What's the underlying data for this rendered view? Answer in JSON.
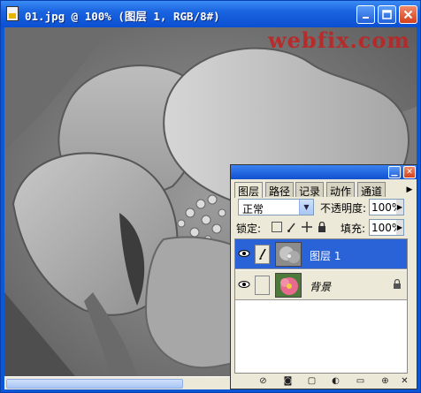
{
  "window": {
    "title": "01.jpg @ 100% (图层 1, RGB/8#)",
    "watermark": "webfix.com"
  },
  "layers_panel": {
    "tabs": [
      "图层",
      "路径",
      "记录",
      "动作",
      "通道"
    ],
    "active_tab": "图层",
    "blend_mode": "正常",
    "opacity_label": "不透明度:",
    "opacity_value": "100%",
    "lock_label": "锁定:",
    "fill_label": "填充:",
    "fill_value": "100%",
    "layers": [
      {
        "name": "图层 1",
        "selected": true,
        "locked": false
      },
      {
        "name": "背景",
        "selected": false,
        "locked": true
      }
    ]
  },
  "icons": {
    "window_minimize": "minimize-icon",
    "window_maximize": "maximize-icon",
    "window_close": "close-icon",
    "eye": "eye-icon",
    "brush": "brush-icon",
    "lock": "lock-icon",
    "bottom_bar": [
      "link-layers-icon",
      "layer-style-icon",
      "layer-mask-icon",
      "new-group-icon",
      "adjustment-layer-icon",
      "new-layer-icon",
      "delete-layer-icon"
    ]
  },
  "colors": {
    "titlebar": "#0b4fd0",
    "selected_layer": "#2a63d8",
    "panel_bg": "#ece9d8",
    "watermark": "#c42020"
  }
}
